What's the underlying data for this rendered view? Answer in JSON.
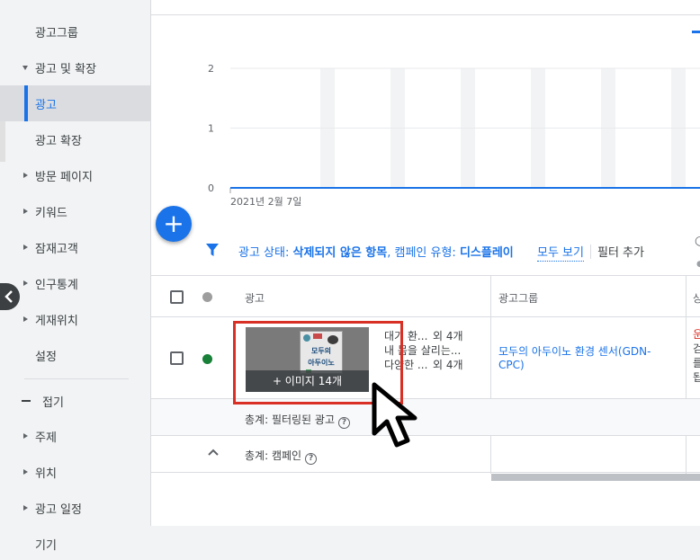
{
  "sidebar": {
    "items": [
      {
        "label": "광고그룹",
        "caret": "none"
      },
      {
        "label": "광고 및 확장",
        "caret": "down"
      },
      {
        "label": "광고",
        "caret": "none",
        "selected": true
      },
      {
        "label": "광고 확장",
        "caret": "none"
      },
      {
        "label": "방문 페이지",
        "caret": "right"
      },
      {
        "label": "키워드",
        "caret": "right"
      },
      {
        "label": "잠재고객",
        "caret": "right"
      },
      {
        "label": "인구통계",
        "caret": "right"
      },
      {
        "label": "게재위치",
        "caret": "right"
      },
      {
        "label": "설정",
        "caret": "none"
      }
    ],
    "collapse_label": "접기",
    "items2": [
      {
        "label": "주제",
        "caret": "right"
      },
      {
        "label": "위치",
        "caret": "right"
      },
      {
        "label": "광고 일정",
        "caret": "right"
      },
      {
        "label": "기기",
        "caret": "none"
      }
    ]
  },
  "chart_data": {
    "type": "line",
    "x": [
      "2021년 2월 7일"
    ],
    "series": [
      {
        "values": [
          0
        ]
      }
    ],
    "y_ticks": [
      "2",
      "1",
      "0"
    ],
    "ylim": [
      0,
      2
    ],
    "grid": true
  },
  "filter": {
    "prefix": "광고 상태: ",
    "status_value": "삭제되지 않은 항목",
    "mid": ", 캠페인 유형: ",
    "type_value": "디스플레이",
    "view_all": "모두 보기",
    "add_filter": "필터 추가"
  },
  "table": {
    "headers": {
      "ad": "광고",
      "adgroup": "광고그룹"
    },
    "row": {
      "thumb_overlay": "+ 이미지 14개",
      "headline": "대기 환...",
      "headline_more": "외 4개",
      "description": "내 몸을 살리는...",
      "long_headline": "다양한 ...",
      "long_headline_more": "외 4개",
      "adgroup": "모두의 아두이노 환경 센서(GDN-CPC)",
      "book_title_1": "모두의",
      "book_title_2": "아두이노"
    },
    "total_filtered": "총계: 필터링된 광고",
    "total_campaign": "총계: 캠페인"
  },
  "colors": {
    "accent": "#1a73e8",
    "status_enabled": "#188038",
    "highlight_box": "#d93025"
  }
}
